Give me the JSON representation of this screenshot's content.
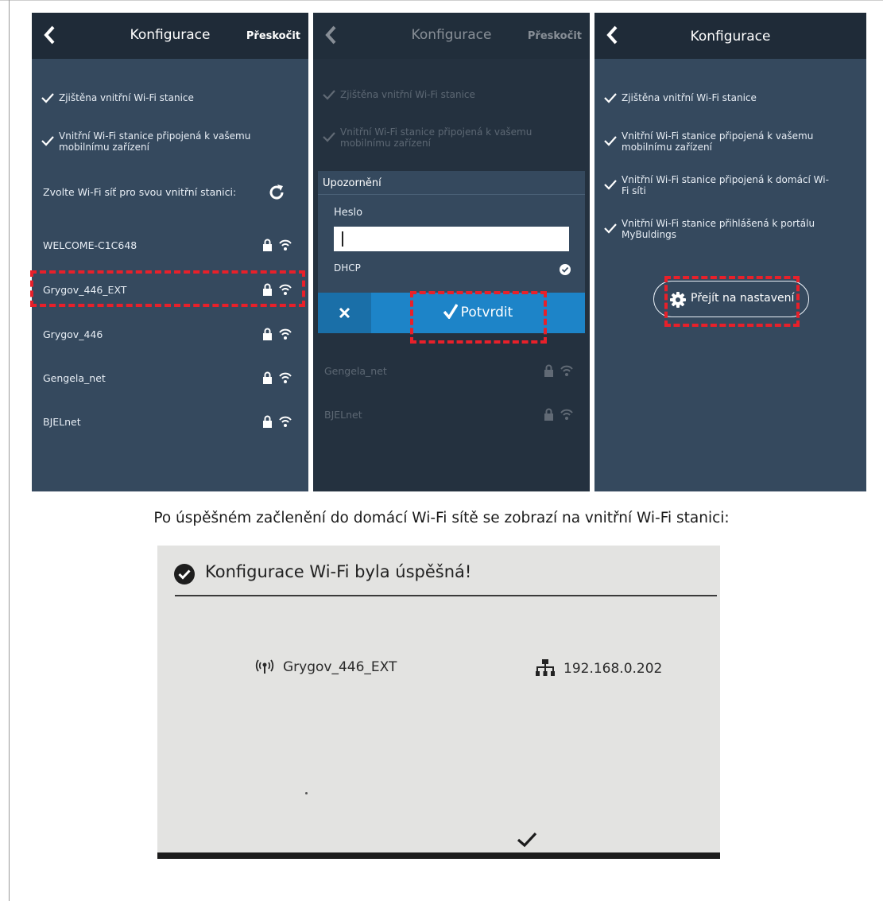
{
  "screen1": {
    "title": "Konfigurace",
    "skip": "Přeskočit",
    "steps": [
      "Zjištěna vnitřní Wi-Fi stanice",
      "Vnitřní Wi-Fi stanice připojená k vašemu mobilnímu zařízení"
    ],
    "prompt": "Zvolte Wi-Fi síť pro svou vnitřní stanici:",
    "networks": [
      "WELCOME-C1C648",
      "Grygov_446_EXT",
      "Grygov_446",
      "Gengela_net",
      "BJELnet"
    ]
  },
  "screen2": {
    "title": "Konfigurace",
    "skip": "Přeskočit",
    "steps": [
      "Zjištěna vnitřní Wi-Fi stanice",
      "Vnitřní Wi-Fi stanice připojená k vašemu mobilnímu zařízení"
    ],
    "networks": [
      "Gengela_net",
      "BJELnet"
    ],
    "dialog": {
      "title": "Upozornění",
      "password_label": "Heslo",
      "password_value": "",
      "dhcp_label": "DHCP",
      "dhcp_checked": true,
      "confirm_label": "Potvrdit"
    }
  },
  "screen3": {
    "title": "Konfigurace",
    "steps": [
      "Zjištěna vnitřní Wi-Fi stanice",
      "Vnitřní Wi-Fi stanice připojená k vašemu mobilnímu zařízení",
      "Vnitřní Wi-Fi stanice připojená k domácí Wi-Fi síti",
      "Vnitřní Wi-Fi stanice přihlášená k portálu MyBuldings"
    ],
    "settings_button": "Přejít na nastavení"
  },
  "caption": "Po úspěšném začlenění do domácí Wi-Fi sítě se zobrazí na vnitřní Wi-Fi stanici:",
  "station": {
    "title": "Konfigurace Wi-Fi byla úspěšná!",
    "ssid": "Grygov_446_EXT",
    "ip": "192.168.0.202"
  },
  "colors": {
    "panel": "#35495e",
    "header": "#1f2b38",
    "accent": "#1d84c8",
    "highlight": "#e8202a"
  }
}
